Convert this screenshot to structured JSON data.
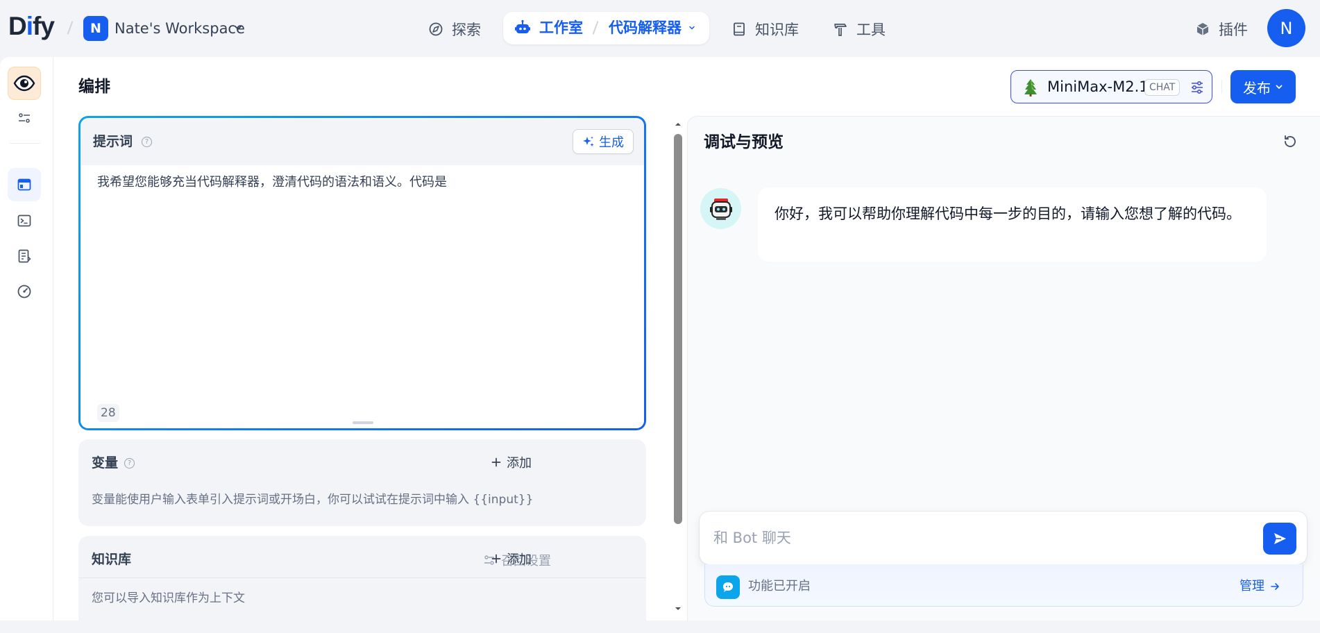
{
  "brand": {
    "name_start": "D",
    "name_mid": "i",
    "name_end": "fy"
  },
  "workspace": {
    "initial": "N",
    "name": "Nate's Workspace"
  },
  "nav": {
    "explore": "探索",
    "studio": "工作室",
    "app_name": "代码解释器",
    "knowledge": "知识库",
    "tools": "工具",
    "plugins": "插件"
  },
  "user": {
    "initial": "N"
  },
  "editor": {
    "title": "编排"
  },
  "model": {
    "name": "MiniMax-M2.1",
    "mode": "CHAT"
  },
  "publish": {
    "label": "发布"
  },
  "prompt": {
    "title": "提示词",
    "help": "?",
    "generate": "生成",
    "text": "我希望您能够充当代码解释器，澄清代码的语法和语义。代码是",
    "char_count": "28"
  },
  "variables": {
    "title": "变量",
    "help": "?",
    "add": "添加",
    "description": "变量能使用户输入表单引入提示词或开场白，你可以试试在提示词中输入 {{input}}"
  },
  "knowledge": {
    "title": "知识库",
    "recall": "召回设置",
    "add": "添加",
    "description": "您可以导入知识库作为上下文"
  },
  "debug": {
    "title": "调试与预览",
    "bot_message": "你好，我可以帮助你理解代码中每一步的目的，请输入您想了解的代码。",
    "input_placeholder": "和 Bot 聊天",
    "features_enabled": "功能已开启",
    "manage": "管理"
  },
  "colors": {
    "primary": "#155eef",
    "accent_cyan": "#0ba5ec",
    "rail_app_bg": "#fdead7"
  }
}
